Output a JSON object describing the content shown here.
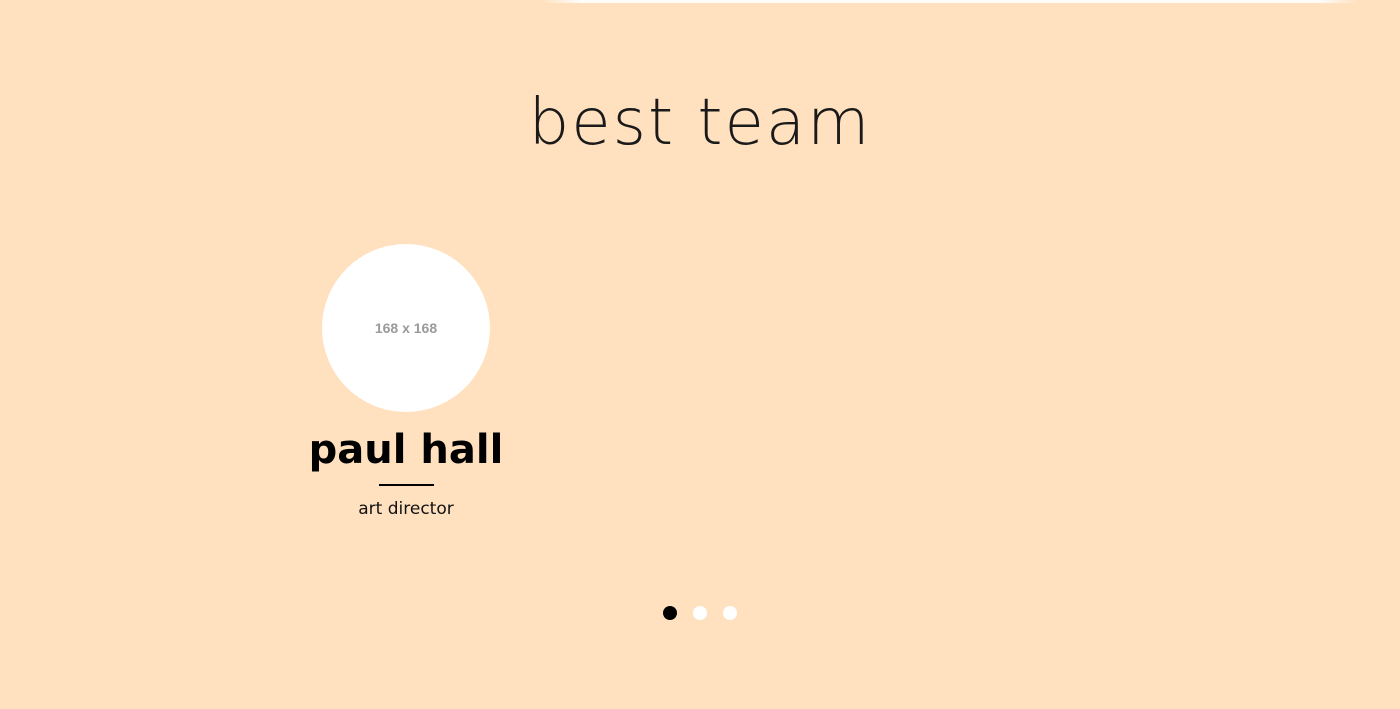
{
  "section": {
    "title": "best team"
  },
  "member": {
    "avatar_placeholder": "168 x 168",
    "name": "paul hall",
    "role": "art director"
  },
  "carousel": {
    "slides": 3,
    "active_index": 0
  },
  "colors": {
    "background": "#ffe1bf",
    "accent": "#000000",
    "dot_inactive": "#ffffff"
  }
}
